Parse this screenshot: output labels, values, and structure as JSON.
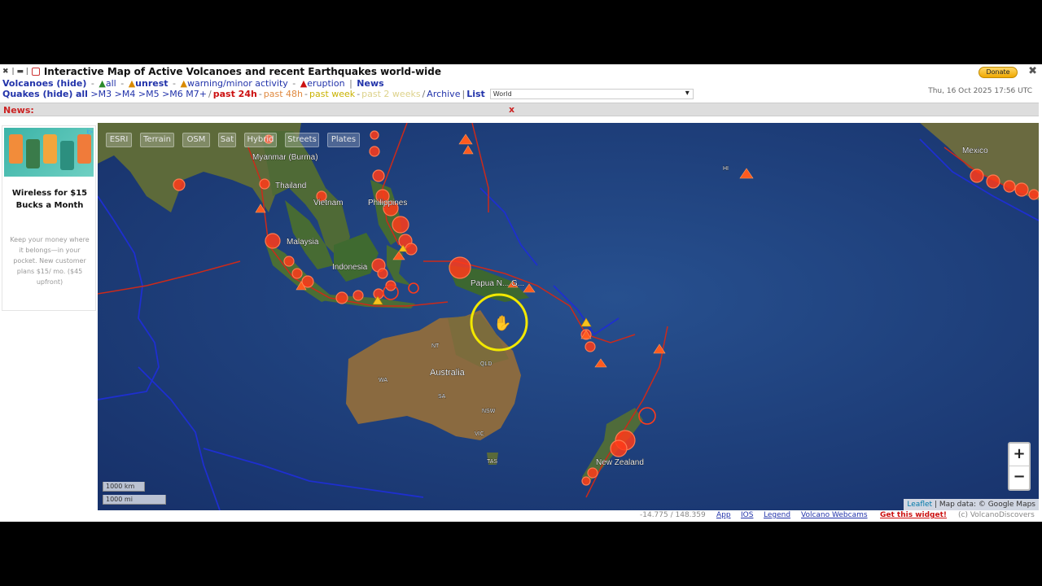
{
  "header": {
    "title": "Interactive Map of Active Volcanoes and recent Earthquakes world-wide",
    "donate_label": "Donate",
    "date": "Thu, 16 Oct 2025 17:56 UTC",
    "volcanoes": {
      "label": "Volcanoes (hide)",
      "all": "all",
      "unrest": "unrest",
      "warning": "warning/minor activity",
      "eruption": "eruption",
      "news": "News"
    },
    "quakes": {
      "label": "Quakes (hide)",
      "all": "all",
      "m3": ">M3",
      "m4": ">M4",
      "m5": ">M5",
      "m6": ">M6",
      "m7": "M7+",
      "p24h": "past 24h",
      "p48h": "past 48h",
      "pweek": "past week",
      "p2weeks": "past 2 weeks",
      "archive": "Archive",
      "list": "List",
      "region": "World"
    }
  },
  "news": {
    "label": "News:",
    "close": "x"
  },
  "ad": {
    "info": "i▷",
    "headline": "Wireless for $15 Bucks a Month",
    "body": "Keep your money where it belongs—in your pocket. New customer plans $15/ mo. ($45 upfront)"
  },
  "map": {
    "buttons": [
      "ESRI",
      "Terrain",
      "OSM",
      "Sat",
      "Hybrid",
      "Streets",
      "Plates"
    ],
    "zoom_in": "+",
    "zoom_out": "−",
    "scale_km": "1000 km",
    "scale_mi": "1000 mi",
    "attribution_leaflet": "Leaflet",
    "attribution_rest": "| Map data: © Google Maps",
    "labels": {
      "myanmar": "Myanmar (Burma)",
      "thailand": "Thailand",
      "vietnam": "Vietnam",
      "philippines": "Philippines",
      "malaysia": "Malaysia",
      "indonesia": "Indonesia",
      "papua": "Papua N... G...",
      "australia": "Australia",
      "newzealand": "New Zealand",
      "mexico": "Mexico",
      "hi": "HI",
      "nt": "NT",
      "qld": "QLD",
      "wa": "WA",
      "sa": "SA",
      "nsw": "NSW",
      "vic": "VIC",
      "tas": "TAS"
    }
  },
  "footer": {
    "coords": "-14.775 / 148.359",
    "app": "App",
    "ios": "IOS",
    "legend": "Legend",
    "webcams": "Volcano Webcams",
    "widget": "Get this widget!",
    "copyright": "(c) VolcanoDiscovers"
  },
  "colors": {
    "ocean": "#1c3a75",
    "quake": "#ff3b1a",
    "plate_boundary": "#cc2a1a",
    "blue_lines": "#1e2fd0",
    "cursor_ring": "#f2e800"
  }
}
